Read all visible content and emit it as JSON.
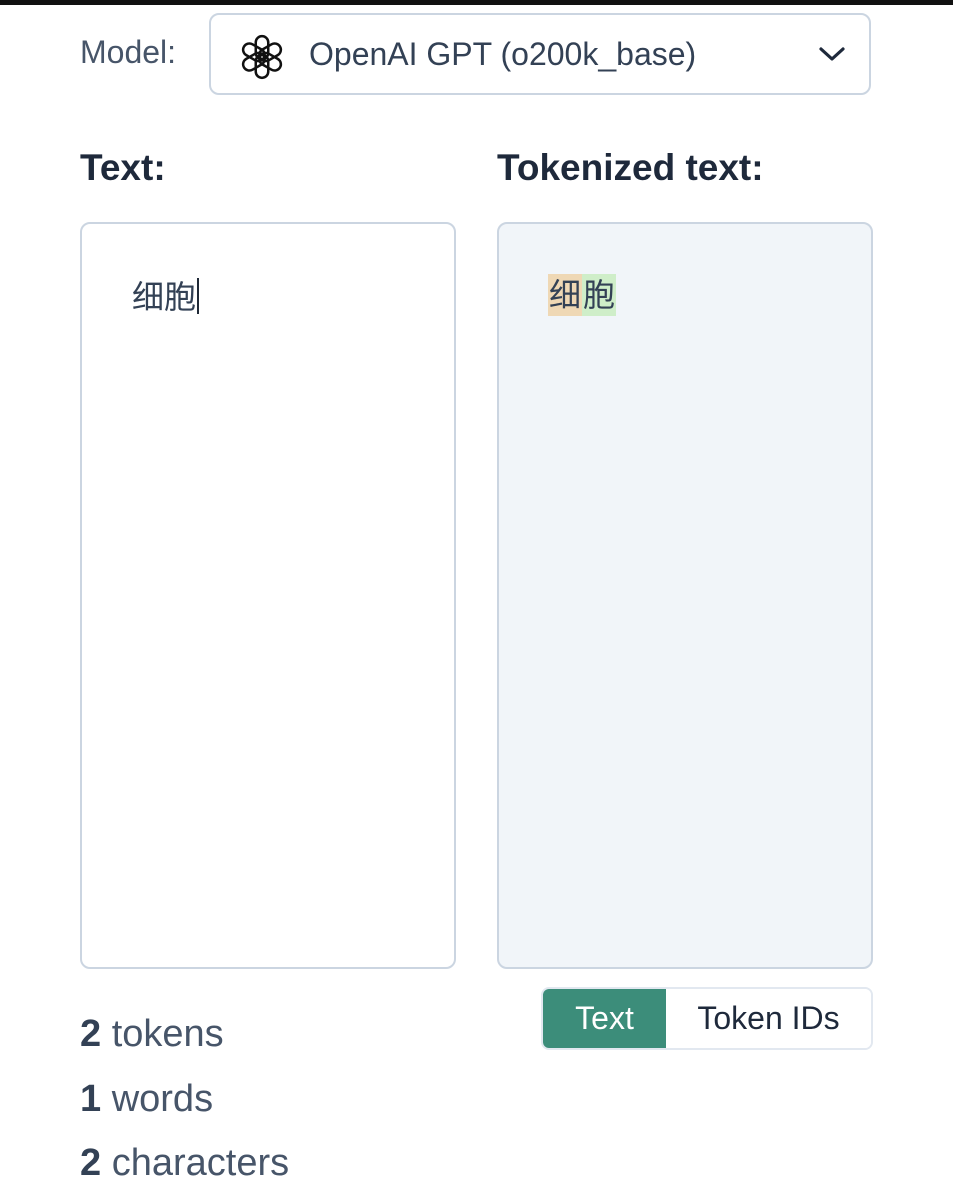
{
  "model": {
    "label": "Model:",
    "selected": "OpenAI GPT (o200k_base)",
    "icon": "openai-logo-icon"
  },
  "input_section": {
    "title": "Text:",
    "value": "细胞"
  },
  "output_section": {
    "title": "Tokenized text:",
    "tokens": [
      {
        "text": "细",
        "color": "#efd8b5"
      },
      {
        "text": "胞",
        "color": "#cfeec9"
      }
    ]
  },
  "view_toggle": {
    "text_label": "Text",
    "ids_label": "Token IDs",
    "active": "Text",
    "active_color": "#3c8d7a"
  },
  "stats": {
    "tokens_count": "2",
    "tokens_label": "tokens",
    "words_count": "1",
    "words_label": "words",
    "characters_count": "2",
    "characters_label": "characters"
  }
}
